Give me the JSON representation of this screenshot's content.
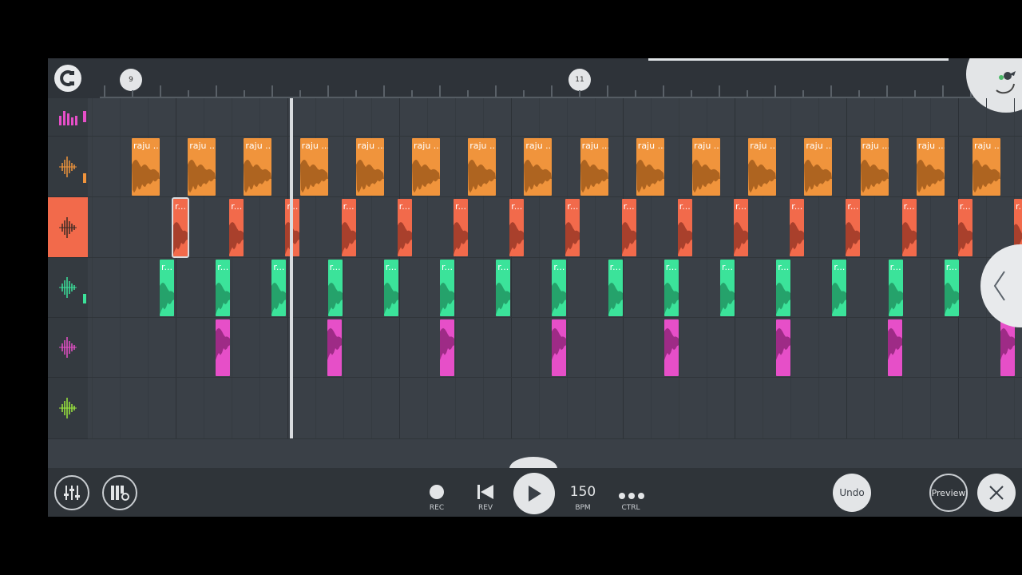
{
  "timeline": {
    "bar_markers": [
      "9",
      "11"
    ],
    "snap_icon": "magnet-icon"
  },
  "tracks": [
    {
      "icon": "equalizer-icon",
      "color": "#e64fc8",
      "clip_label": ""
    },
    {
      "icon": "waveform-icon",
      "color": "#f0943c",
      "clip_label": "raju ..."
    },
    {
      "icon": "waveform-icon",
      "color": "#f26a4b",
      "clip_label": "r..."
    },
    {
      "icon": "waveform-icon",
      "color": "#3be39a",
      "clip_label": "r..."
    },
    {
      "icon": "waveform-icon",
      "color": "#e64fc8",
      "clip_label": ""
    },
    {
      "icon": "waveform-icon",
      "color": "#9be83e",
      "clip_label": ""
    }
  ],
  "transport": {
    "rec_label": "REC",
    "rev_label": "REV",
    "tempo": "150",
    "tempo_label": "BPM",
    "ctrl_label": "CTRL"
  },
  "actions": {
    "undo_label": "Undo",
    "preview_label": "Preview"
  },
  "colors": {
    "background": "#3a4047",
    "accent_active_track": "#f26a4b"
  }
}
